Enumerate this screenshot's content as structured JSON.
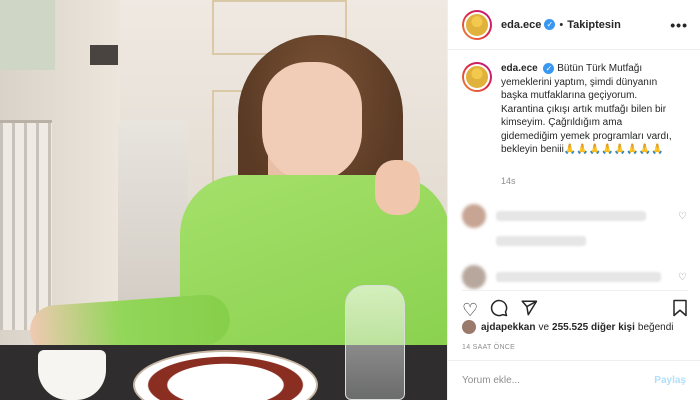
{
  "post": {
    "username": "eda.ece",
    "follow_status": "Takiptesin",
    "separator": "•",
    "more_icon": "more-horizontal-icon",
    "caption_username": "eda.ece",
    "caption_text": "Bütün Türk Mutfağı yemeklerini yaptım, şimdi dünyanın başka mutfaklarına geçiyorum. Karantina çıkışı artık mutfağı bilen bir kimseyim. Çağrıldığım ama gidemediğim yemek programları vardı, bekleyin beniii🙏🙏🙏🙏🙏🙏🙏🙏",
    "caption_time": "14s",
    "liked_by_user": "ajdapekkan",
    "likes_connector": "ve",
    "likes_count": "255.525 diğer kişi",
    "likes_suffix": "beğendi",
    "time_ago": "14 SAAT ÖNCE",
    "comment_placeholder": "Yorum ekle...",
    "post_button": "Paylaş",
    "verified_mark": "✓"
  },
  "icons": {
    "like": "heart-icon",
    "comment": "comment-icon",
    "share": "share-icon",
    "save": "bookmark-icon"
  },
  "colors": {
    "verified": "#3897f0",
    "secondary_text": "#8e8e8e",
    "post_button_disabled": "#b2dffc"
  }
}
